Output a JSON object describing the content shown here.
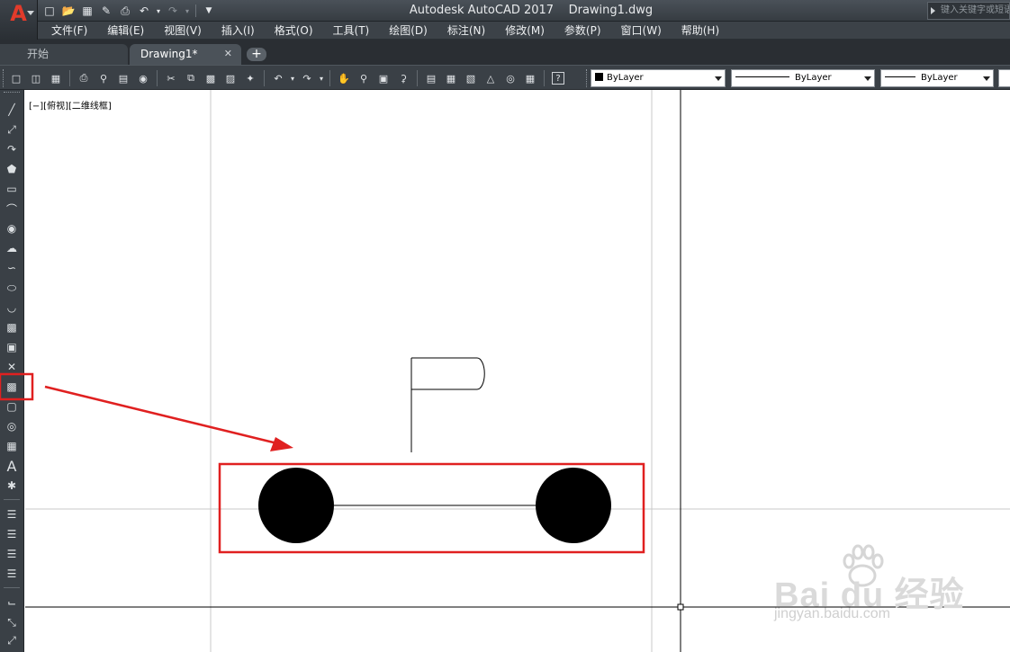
{
  "app": {
    "logo_letter": "A",
    "title": "Autodesk AutoCAD 2017    Drawing1.dwg",
    "search_placeholder": "键入关键字或短语"
  },
  "menu": [
    "文件(F)",
    "编辑(E)",
    "视图(V)",
    "插入(I)",
    "格式(O)",
    "工具(T)",
    "绘图(D)",
    "标注(N)",
    "修改(M)",
    "参数(P)",
    "窗口(W)",
    "帮助(H)"
  ],
  "tabs": {
    "start": "开始",
    "drawing": "Drawing1*",
    "close_glyph": "✕",
    "add_glyph": "+"
  },
  "properties": {
    "color": "ByLayer",
    "linetype": "ByLayer",
    "lineweight": "ByLayer"
  },
  "viewport": {
    "label": "[−][俯视][二维线框]"
  },
  "watermark": {
    "brand": "Bai  du 经验",
    "url": "jingyan.baidu.com"
  },
  "colors": {
    "highlight": "#e02020",
    "accent_logo": "#e23b2b",
    "drawing_fill": "#000000"
  },
  "icons": {
    "qat": [
      "new-icon",
      "open-icon",
      "save-icon",
      "saveas-icon",
      "plot-icon",
      "undo-icon",
      "redo-icon",
      "customize-icon"
    ],
    "left_toolbar": [
      "line-icon",
      "construction-line-icon",
      "polyline-icon",
      "polygon-icon",
      "rectangle-icon",
      "arc-icon",
      "circle-icon",
      "revision-cloud-icon",
      "spline-icon",
      "ellipse-icon",
      "ellipse-arc-icon",
      "insert-block-icon",
      "make-block-icon",
      "point-icon",
      "hatch-icon",
      "region-icon",
      "gradient-icon",
      "table-icon",
      "multiline-text-icon",
      "add-selected-icon"
    ]
  }
}
